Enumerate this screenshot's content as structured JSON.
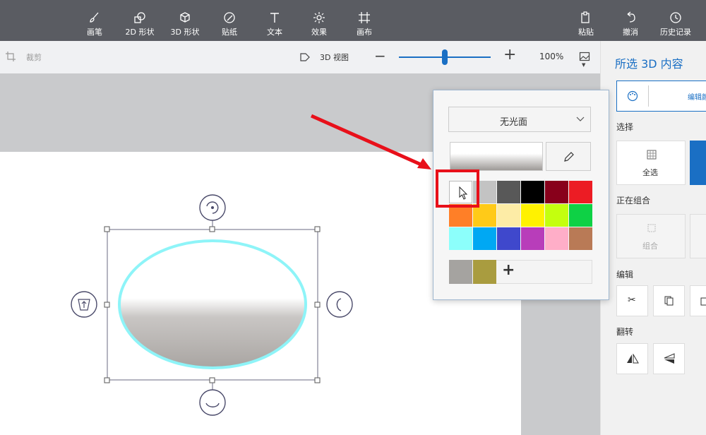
{
  "toolbar": {
    "tools": [
      {
        "label": "画笔",
        "icon": "brush-icon"
      },
      {
        "label": "2D 形状",
        "icon": "shapes-2d-icon"
      },
      {
        "label": "3D 形状",
        "icon": "cube-icon"
      },
      {
        "label": "贴纸",
        "icon": "sticker-icon"
      },
      {
        "label": "文本",
        "icon": "text-icon"
      },
      {
        "label": "效果",
        "icon": "effects-icon"
      },
      {
        "label": "画布",
        "icon": "canvas-icon"
      }
    ],
    "right_tools": [
      {
        "label": "粘贴",
        "icon": "paste-icon"
      },
      {
        "label": "撤消",
        "icon": "undo-icon"
      },
      {
        "label": "历史记录",
        "icon": "history-icon"
      }
    ]
  },
  "subbar": {
    "crop_label": "裁剪",
    "view3d_label": "3D 视图",
    "zoom_value": "100%",
    "zoom_level": 0.5
  },
  "popup": {
    "finish_select": "无光面",
    "colors_row1": [
      "#ffffff",
      "#c3c3c3",
      "#585858",
      "#000000",
      "#88001b",
      "#ec1c24"
    ],
    "colors_row2": [
      "#ff7f27",
      "#ffca18",
      "#fdeca6",
      "#fff200",
      "#c4ff0e",
      "#0ed145"
    ],
    "colors_row3": [
      "#8cfffb",
      "#00a8f3",
      "#3f48cc",
      "#b83dba",
      "#ffaec8",
      "#b97a56"
    ],
    "custom_colors": [
      "#a5a3a0",
      "#a99c3f"
    ],
    "add_label": "+"
  },
  "rightpanel": {
    "title": "所选 3D 内容",
    "edit_color_label": "编辑颜",
    "select_section": "选择",
    "select_all": "全选",
    "group_section": "正在组合",
    "group_label": "组合",
    "edit_section": "编辑",
    "flip_section": "翻转"
  },
  "colors": {
    "accent": "#1a6fc4",
    "annotation_red": "#e8101a",
    "outline_cyan": "#8ef4f8"
  }
}
